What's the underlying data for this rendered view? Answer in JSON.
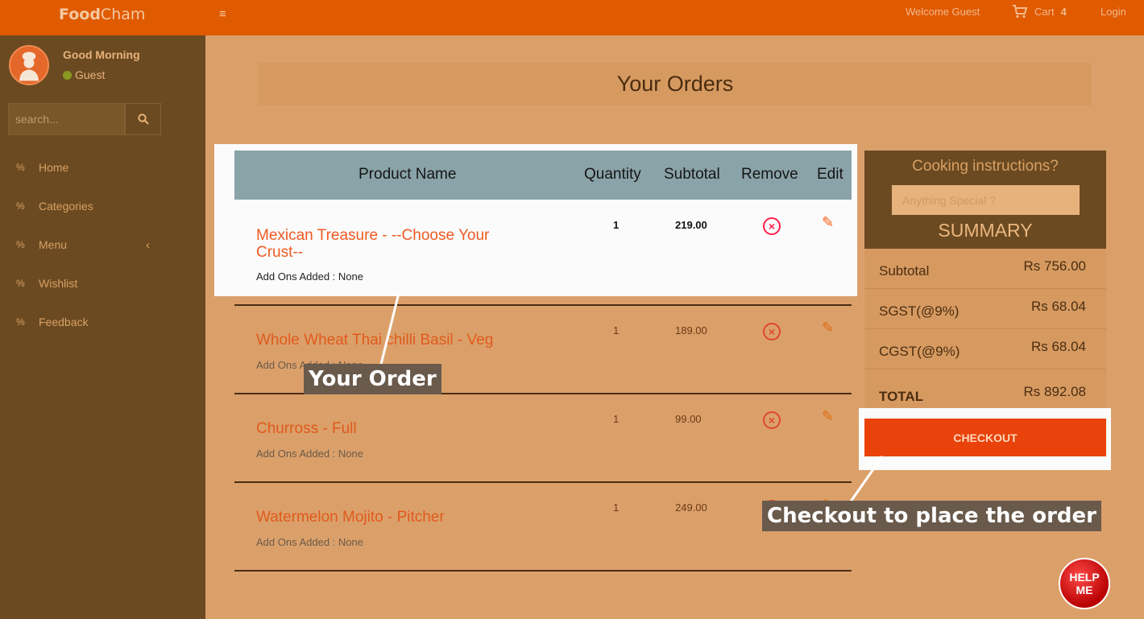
{
  "header": {
    "brand_bold": "Food",
    "brand_rest": "Cham",
    "menu_icon": "hamburger-icon",
    "welcome": "Welcome Guest",
    "cart_label": "Cart",
    "cart_count": "4",
    "login": "Login"
  },
  "sidebar": {
    "greeting": "Good Morning",
    "user": "Guest",
    "search_placeholder": "search...",
    "items": [
      {
        "label": "Home"
      },
      {
        "label": "Categories"
      },
      {
        "label": "Menu"
      },
      {
        "label": "Wishlist"
      },
      {
        "label": "Feedback"
      }
    ]
  },
  "main": {
    "title": "Your Orders",
    "columns": [
      "Product Name",
      "Quantity",
      "Subtotal",
      "Remove",
      "Edit"
    ],
    "rows": [
      {
        "name": "Mexican Treasure - --Choose Your Crust--",
        "addons": "Add Ons Added : None",
        "qty": "1",
        "subtotal": "219.00"
      },
      {
        "name": "Whole Wheat Thai chilli Basil - Veg",
        "addons": "Add Ons Added : None",
        "qty": "1",
        "subtotal": "189.00"
      },
      {
        "name": "Churross - Full",
        "addons": "Add Ons Added : None",
        "qty": "1",
        "subtotal": "99.00"
      },
      {
        "name": "Watermelon Mojito - Pitcher",
        "addons": "Add Ons Added : None",
        "qty": "1",
        "subtotal": "249.00"
      }
    ]
  },
  "summary": {
    "cooking_title": "Cooking instructions?",
    "cooking_placeholder": "Anything Special ?",
    "title": "SUMMARY",
    "rows": [
      {
        "label": "Subtotal",
        "value": "Rs 756.00"
      },
      {
        "label": "SGST(@9%)",
        "value": "Rs 68.04"
      },
      {
        "label": "CGST(@9%)",
        "value": "Rs 68.04"
      },
      {
        "label": "TOTAL",
        "value": "Rs 892.08"
      }
    ],
    "checkout": "CHECKOUT"
  },
  "callouts": {
    "order": "Your Order",
    "checkout": "Checkout to place the order"
  },
  "help": {
    "line1": "HELP",
    "line2": "ME"
  },
  "colors": {
    "topbar": "#e05a00",
    "sidebar": "#6b4a21",
    "background": "#dba06a",
    "accent": "#e9420b"
  }
}
